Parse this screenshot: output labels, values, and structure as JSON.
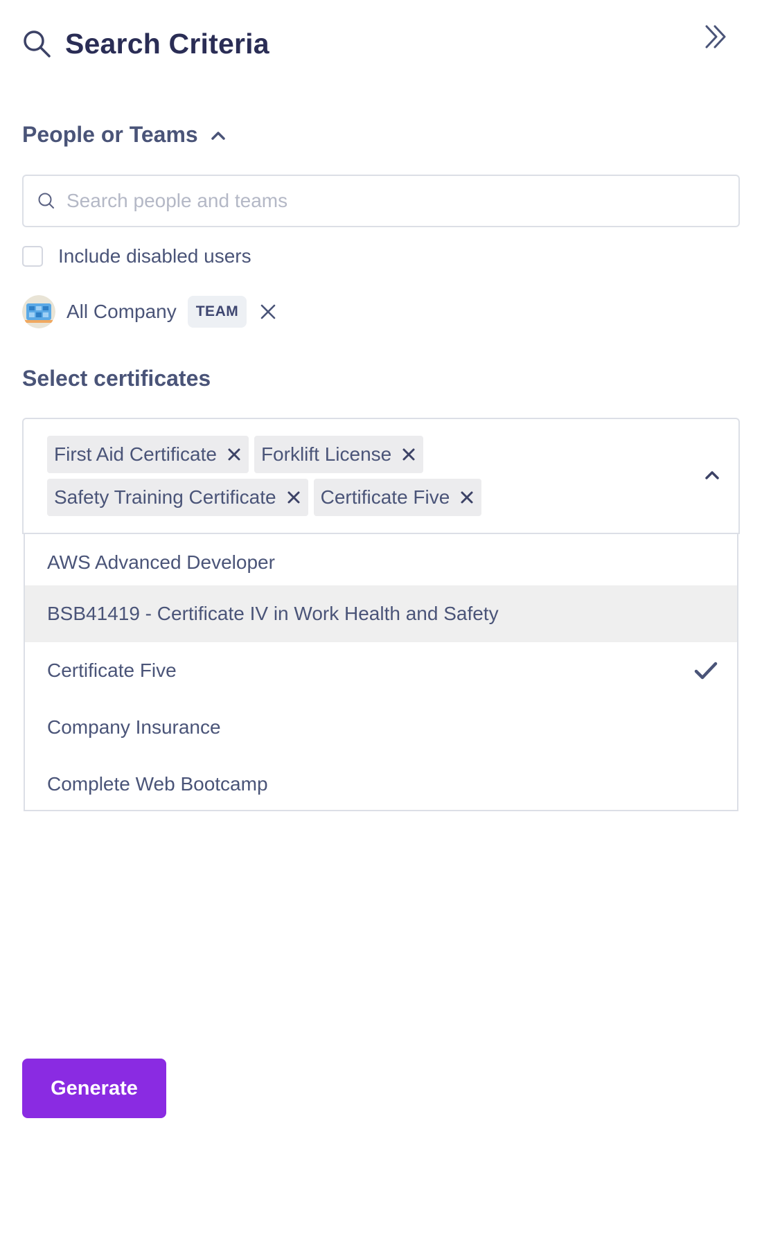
{
  "header": {
    "title": "Search Criteria",
    "icon": "search-icon",
    "collapse_icon": "double-chevron-right-icon"
  },
  "people_section": {
    "label": "People or Teams",
    "search_placeholder": "Search people and teams",
    "search_value": "",
    "include_disabled_label": "Include disabled users",
    "include_disabled_checked": false,
    "selected": [
      {
        "name": "All Company",
        "badge": "TEAM"
      }
    ]
  },
  "certificates_section": {
    "label": "Select certificates",
    "selected_chips": [
      "First Aid Certificate",
      "Forklift License",
      "Safety Training Certificate",
      "Certificate Five"
    ],
    "options": [
      {
        "label": "AWS Advanced Developer",
        "highlighted": false,
        "checked": false
      },
      {
        "label": "BSB41419 - Certificate IV in Work Health and Safety",
        "highlighted": true,
        "checked": false
      },
      {
        "label": "Certificate Five",
        "highlighted": false,
        "checked": true
      },
      {
        "label": "Company Insurance",
        "highlighted": false,
        "checked": false
      },
      {
        "label": "Complete Web Bootcamp",
        "highlighted": false,
        "checked": false
      }
    ]
  },
  "generate_label": "Generate",
  "colors": {
    "primary": "#8a2be2",
    "heading": "#2a2d55",
    "text": "#4a5478",
    "border": "#dcdfe6",
    "chip_bg": "#ececee"
  }
}
